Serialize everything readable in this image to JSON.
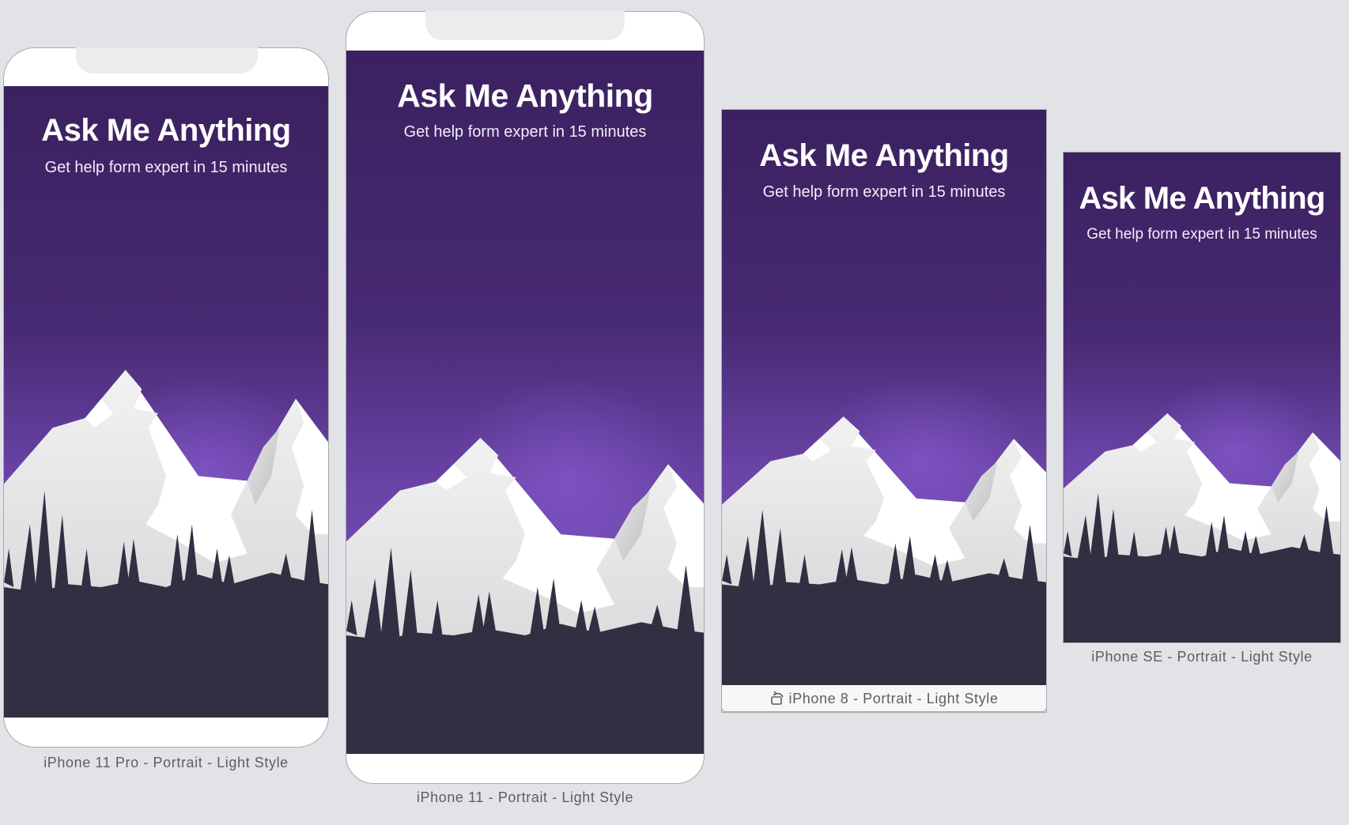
{
  "app_title": "Ask Me Anything",
  "app_subtitle": "Get help form expert in 15 minutes",
  "devices": [
    {
      "label": "iPhone 11 Pro - Portrait - Light Style"
    },
    {
      "label": "iPhone 11 - Portrait - Light Style"
    },
    {
      "label": "iPhone 8 - Portrait - Light Style",
      "icon": "rotate-device-icon"
    },
    {
      "label": "iPhone SE - Portrait - Light Style"
    }
  ],
  "colors": {
    "canvas": "#e2e3e7",
    "sky_top": "#3b2160",
    "sky_glow": "#6e48ad",
    "ground": "#332e42",
    "snow": "#ffffff",
    "rock": "#cfcfd1"
  }
}
